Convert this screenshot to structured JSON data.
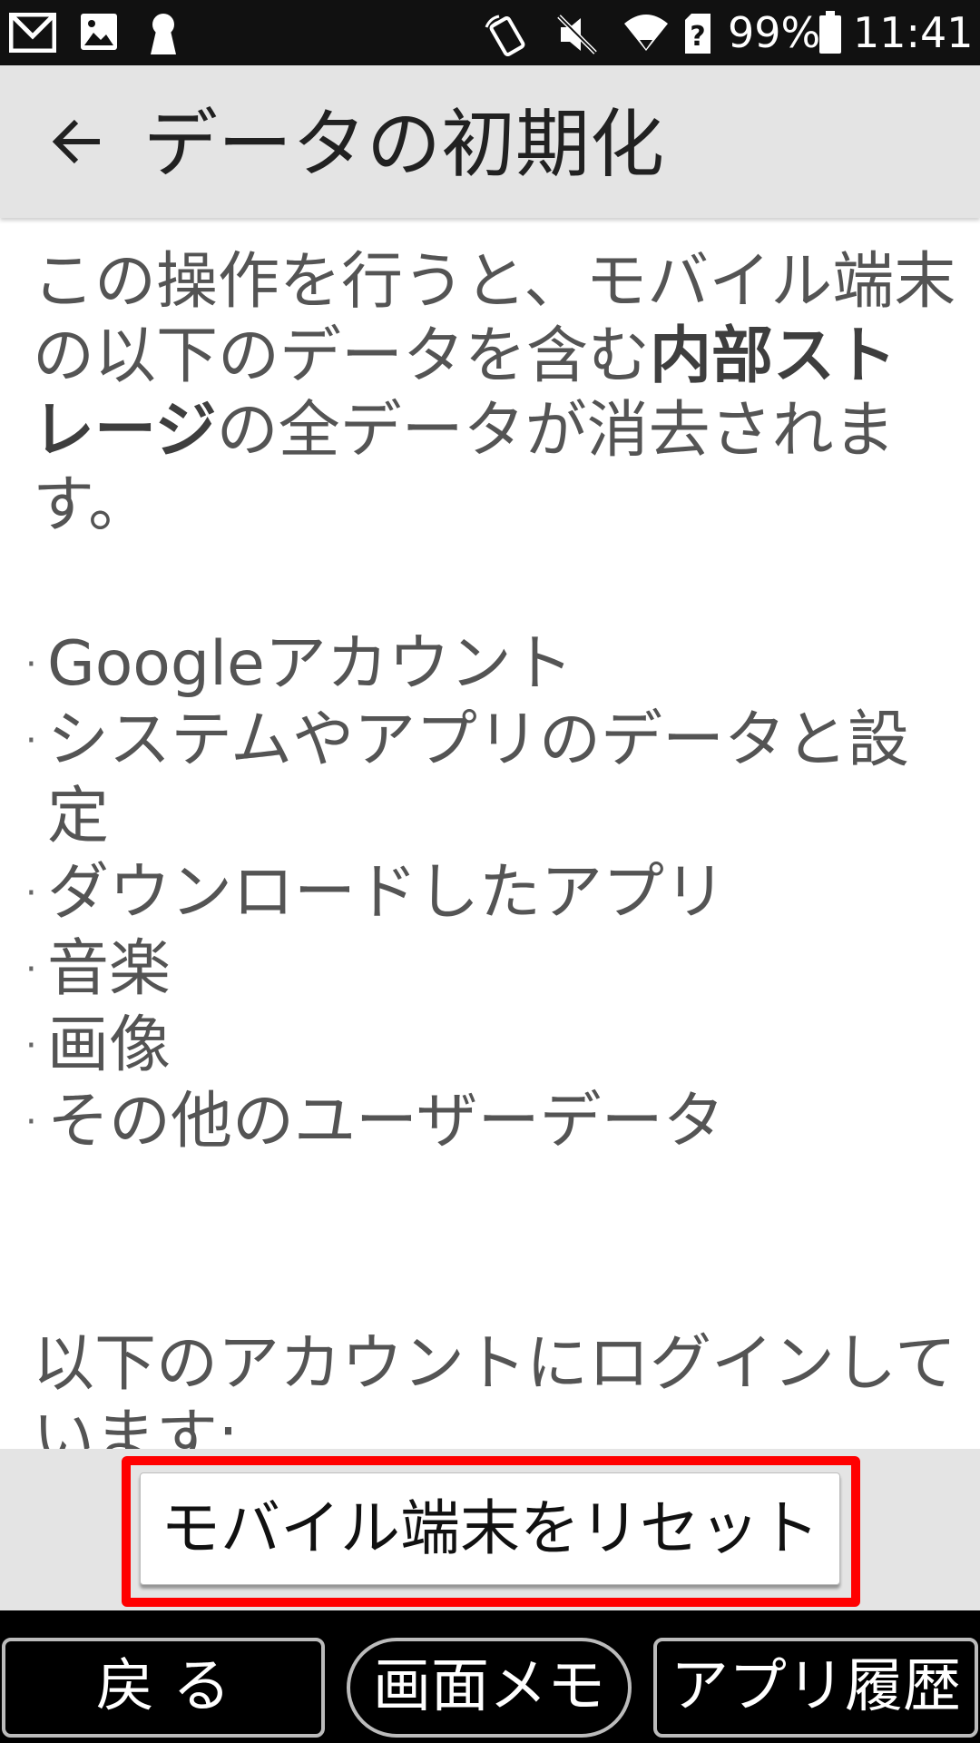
{
  "status_bar": {
    "icons": [
      "gmail-icon",
      "image-icon",
      "keyhole-icon",
      "nfc-phone-icon",
      "mute-icon",
      "wifi-icon",
      "sim-unknown-icon",
      "battery-icon"
    ],
    "battery": "99%",
    "time": "11:41"
  },
  "app_bar": {
    "title": "データの初期化",
    "back_icon": "arrow-left-icon"
  },
  "content": {
    "intro_part1": "この操作を行うと、モバイル端末の以下のデータを含む",
    "intro_bold": "内部ストレージ",
    "intro_part2": "の全データが消去されます。",
    "bullet_mark": "·",
    "bullets": [
      "Googleアカウント",
      "システムやアプリのデータと設定",
      "ダウンロードしたアプリ",
      "音楽",
      "画像",
      "その他のユーザーデータ"
    ],
    "account_note": "以下のアカウントにログインしています:"
  },
  "actions": {
    "reset_button": "モバイル端末をリセット",
    "highlight_color": "#ff0000"
  },
  "bottom_nav": {
    "back": "戻 る",
    "memo": "画面メモ",
    "history": "アプリ履歴"
  }
}
